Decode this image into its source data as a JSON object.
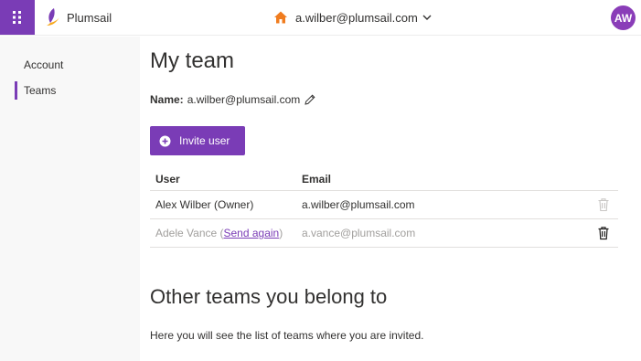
{
  "app": {
    "brand_name": "Plumsail",
    "accent_color": "#7a3cb6"
  },
  "header": {
    "account_email": "a.wilber@plumsail.com",
    "avatar_initials": "AW",
    "icons": [
      "waffle-icon",
      "plumsail-logo",
      "home-icon",
      "chevron-down-icon"
    ]
  },
  "sidebar": {
    "items": [
      {
        "label": "Account",
        "active": false
      },
      {
        "label": "Teams",
        "active": true
      }
    ]
  },
  "main": {
    "title": "My team",
    "name_label": "Name:",
    "name_value": "a.wilber@plumsail.com",
    "invite_button": "Invite user",
    "table": {
      "headers": [
        "User",
        "Email"
      ],
      "rows": [
        {
          "user": "Alex Wilber (Owner)",
          "email": "a.wilber@plumsail.com",
          "status": "active",
          "delete_enabled": false
        },
        {
          "user_prefix": "Adele Vance (",
          "user_link": "Send again",
          "user_suffix": ")",
          "email": "a.vance@plumsail.com",
          "status": "pending",
          "delete_enabled": true
        }
      ]
    },
    "other_title": "Other teams you belong to",
    "other_note": "Here you will see the list of teams where you are invited."
  }
}
